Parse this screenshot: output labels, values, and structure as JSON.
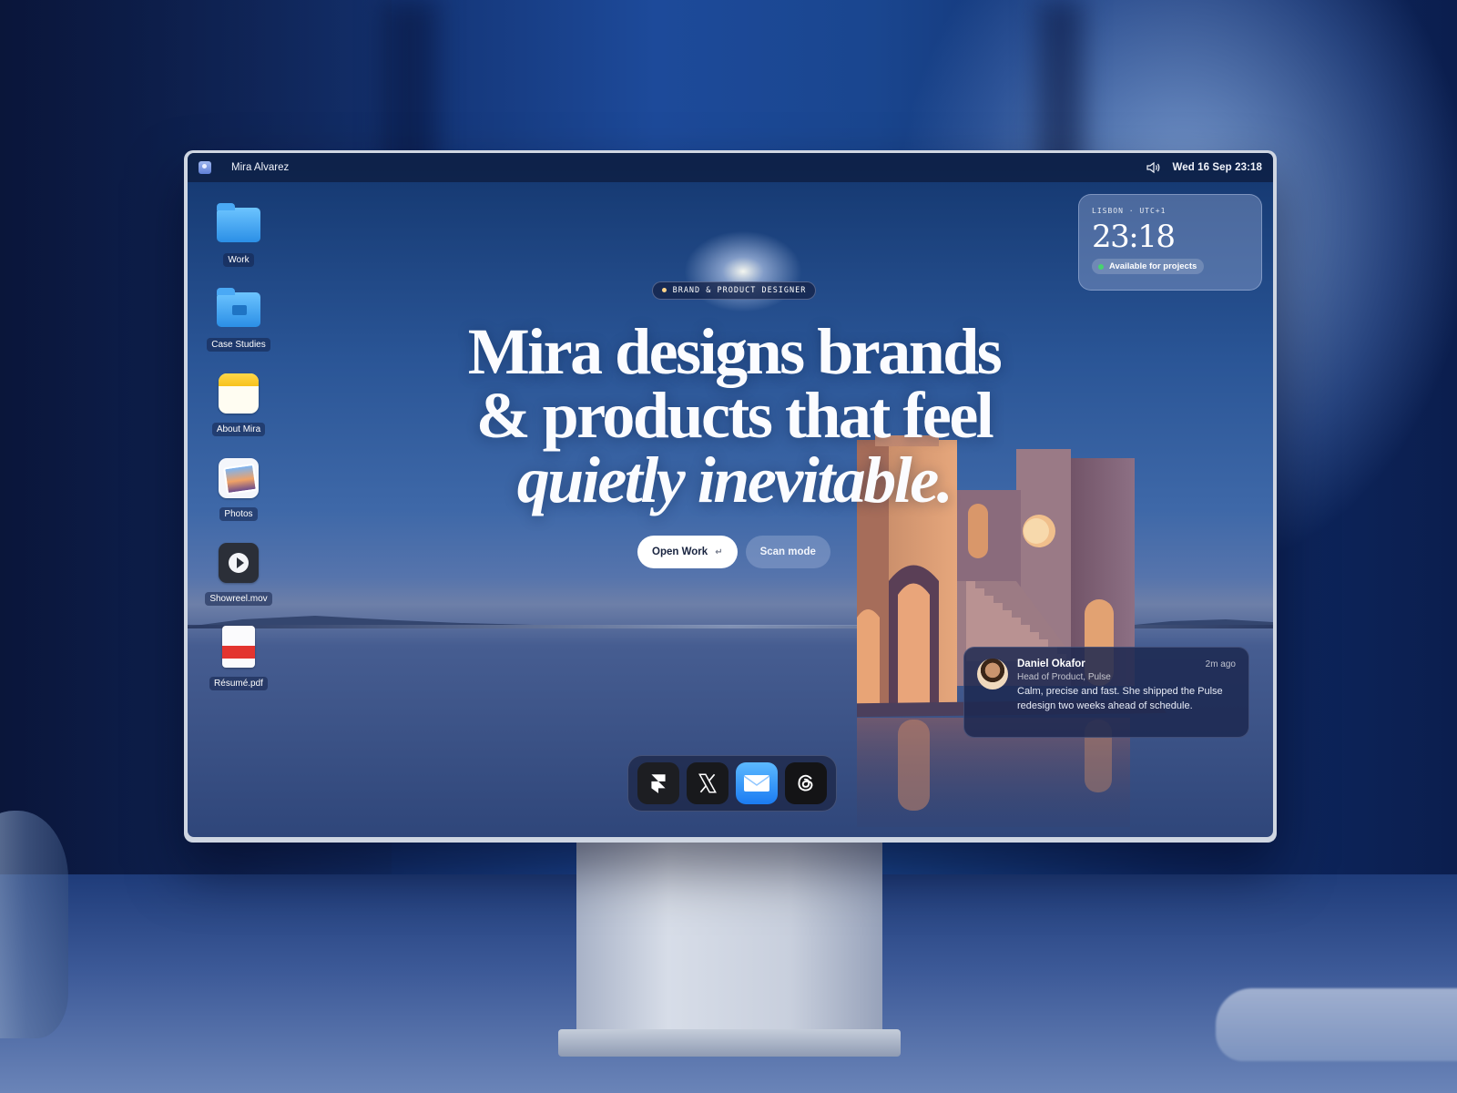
{
  "menubar": {
    "app_name": "Mira Alvarez",
    "datetime": "Wed 16 Sep  23:18",
    "icons": {
      "logo": "app-logo-icon",
      "volume": "speaker-icon"
    }
  },
  "desktop_icons": [
    {
      "label": "Work",
      "icon": "folder-icon"
    },
    {
      "label": "Case Studies",
      "icon": "briefcase-folder-icon"
    },
    {
      "label": "About Mira",
      "icon": "notes-icon"
    },
    {
      "label": "Photos",
      "icon": "photos-icon"
    },
    {
      "label": "Showreel.mov",
      "icon": "movie-file-icon"
    },
    {
      "label": "Résumé.pdf",
      "icon": "pdf-file-icon"
    }
  ],
  "widget": {
    "city": "LISBON · UTC+1",
    "time": "23:18",
    "status": "Available for projects",
    "status_color": "#46d36f"
  },
  "hero": {
    "tag": "BRAND & PRODUCT DESIGNER",
    "headline_line1": "Mira designs brands",
    "headline_line2": "& products that feel",
    "headline_line3": "quietly inevitable.",
    "primary_button": "Open Work",
    "primary_button_hint": "↵",
    "secondary_button": "Scan mode"
  },
  "notification": {
    "name": "Daniel Okafor",
    "time_ago": "2m ago",
    "role": "Head of Product, Pulse",
    "message": "Calm, precise and fast. She shipped the Pulse redesign two weeks ahead of schedule."
  },
  "dock": {
    "apps": [
      {
        "name": "framer-icon"
      },
      {
        "name": "x-icon"
      },
      {
        "name": "mail-icon"
      },
      {
        "name": "threads-icon"
      }
    ]
  },
  "colors": {
    "accent": "#ffffff",
    "screen_sky": "#2a5596",
    "architecture": "#b98a7c"
  }
}
